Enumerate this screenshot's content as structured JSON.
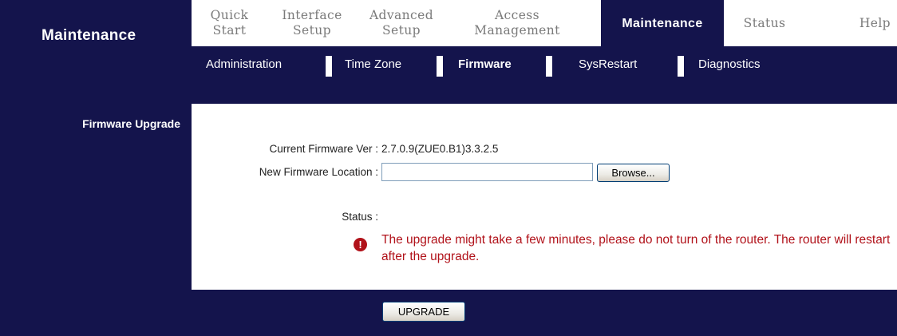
{
  "header": {
    "title": "Maintenance"
  },
  "menu": [
    {
      "label": "Quick\nStart"
    },
    {
      "label": "Interface\nSetup"
    },
    {
      "label": "Advanced\nSetup"
    },
    {
      "label": "Access\nManagement"
    },
    {
      "label": "Maintenance"
    },
    {
      "label": "Status"
    },
    {
      "label": "Help"
    }
  ],
  "menu_active": "Maintenance",
  "submenu": [
    {
      "label": "Administration"
    },
    {
      "label": "Time Zone"
    },
    {
      "label": "Firmware"
    },
    {
      "label": "SysRestart"
    },
    {
      "label": "Diagnostics"
    }
  ],
  "submenu_active": "Firmware",
  "section": {
    "title": "Firmware Upgrade"
  },
  "firmware": {
    "current_label": "Current Firmware Ver :",
    "current_value": "2.7.0.9(ZUE0.B1)3.3.2.5",
    "new_location_label": "New Firmware Location :",
    "new_location_value": "",
    "browse_label": "Browse...",
    "status_label": "Status :",
    "status_message": "The upgrade might take a few minutes, please do not turn of the router. The router will restart after the upgrade.",
    "warning_icon": "exclamation-icon"
  },
  "actions": {
    "upgrade_label": "UPGRADE"
  },
  "colors": {
    "navy": "#14144c",
    "warning": "#b1121a",
    "menu_text": "#7a7a7a"
  }
}
